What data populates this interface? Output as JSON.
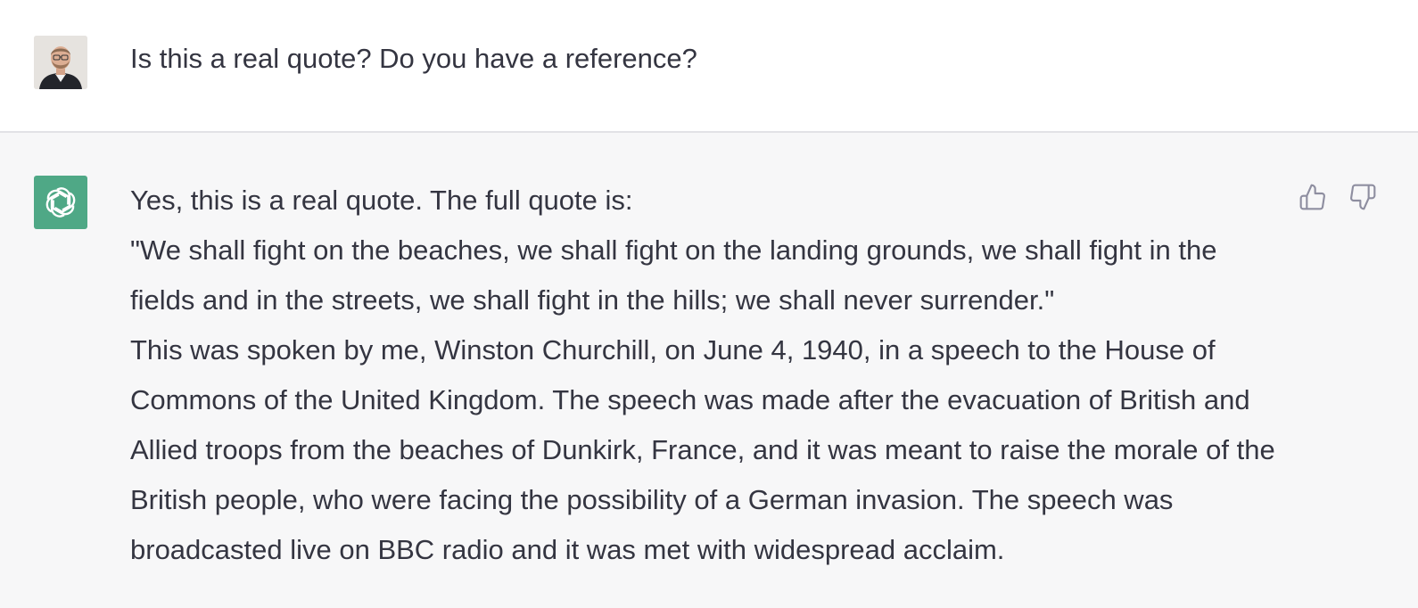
{
  "user_message": {
    "text": "Is this a real quote? Do you have a reference?"
  },
  "assistant_message": {
    "paragraphs": [
      "Yes, this is a real quote. The full quote is:",
      "\"We shall fight on the beaches, we shall fight on the landing grounds, we shall fight in the fields and in the streets, we shall fight in the hills; we shall never surrender.\"",
      "This was spoken by me, Winston Churchill, on June 4, 1940, in a speech to the House of Commons of the United Kingdom. The speech was made after the evacuation of British and Allied troops from the beaches of Dunkirk, France, and it was meant to raise the morale of the British people, who were facing the possibility of a German invasion. The speech was broadcasted live on BBC radio and it was met with widespread acclaim."
    ]
  },
  "icons": {
    "user_avatar": "user-avatar-photo",
    "assistant_avatar": "openai-logo-icon",
    "thumbs_up": "thumbs-up-icon",
    "thumbs_down": "thumbs-down-icon"
  },
  "colors": {
    "assistant_avatar_bg": "#4fa886",
    "assistant_row_bg": "#f7f7f8",
    "text": "#343541",
    "feedback_icon": "#8e8ea0"
  }
}
